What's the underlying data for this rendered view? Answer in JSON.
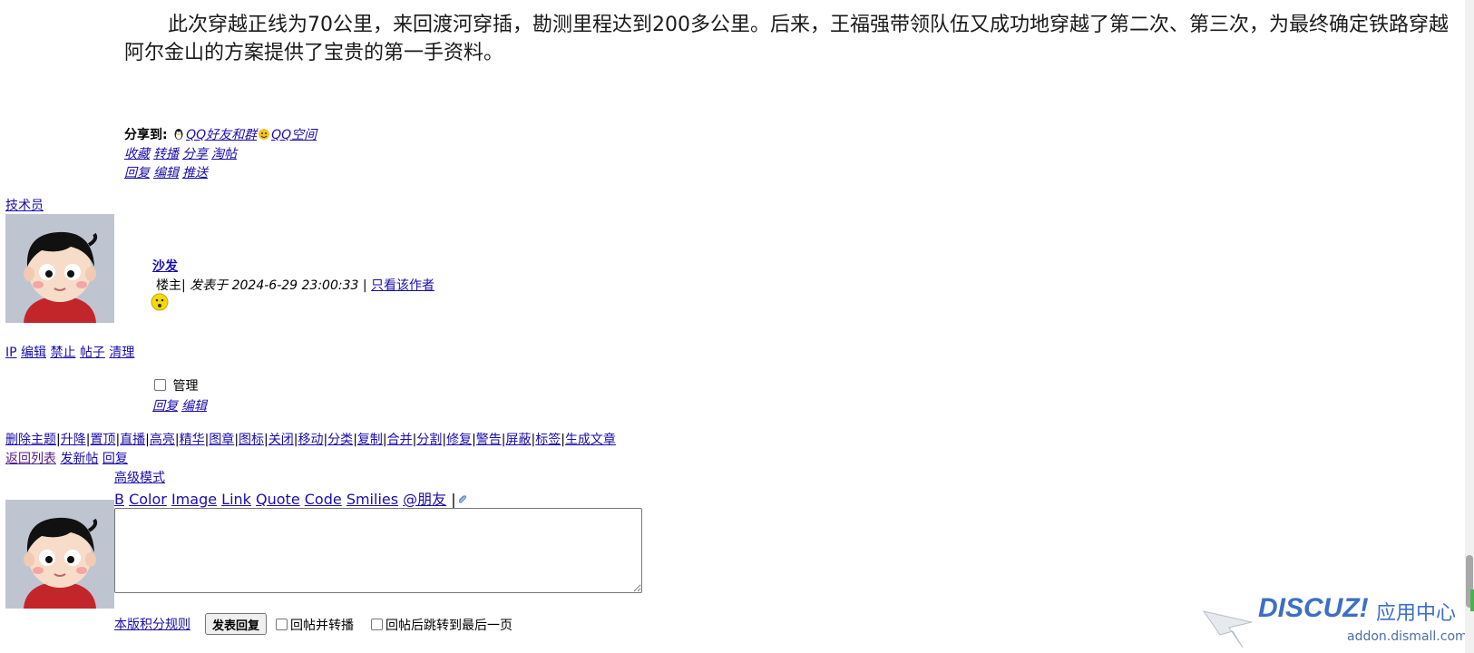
{
  "article": {
    "text": "此次穿越正线为70公里，来回渡河穿插，勘测里程达到200多公里。后来，王福强带领队伍又成功地穿越了第二次、第三次，为最终确定铁路穿越阿尔金山的方案提供了宝贵的第一手资料。"
  },
  "share": {
    "label": "分享到:",
    "qq_friends": "QQ好友和群",
    "qq_zone": "QQ空间"
  },
  "post_actions": {
    "row1": [
      "收藏",
      "转播",
      "分享",
      "淘帖"
    ],
    "row2": [
      "回复",
      "编辑",
      "推送"
    ]
  },
  "reply_post": {
    "author": "技术员",
    "floor": "沙发",
    "role": "楼主",
    "sep": "|",
    "posted_at": "发表于 2024-6-29 23:00:33",
    "only_author": "只看该作者",
    "admin_links": [
      "IP",
      "编辑",
      "禁止",
      "帖子",
      "清理"
    ],
    "manage_label": "管理",
    "actions": [
      "回复",
      "编辑"
    ]
  },
  "mod_bar": [
    "删除主题",
    "升降",
    "置顶",
    "直播",
    "高亮",
    "精华",
    "图章",
    "图标",
    "关闭",
    "移动",
    "分类",
    "复制",
    "合并",
    "分割",
    "修复",
    "警告",
    "屏蔽",
    "标签",
    "生成文章"
  ],
  "nav_links": {
    "back": "返回列表",
    "new_post": "发新帖",
    "reply": "回复"
  },
  "editor": {
    "advanced": "高级模式",
    "toolbar": [
      "B",
      "Color",
      "Image",
      "Link",
      "Quote",
      "Code",
      "Smilies",
      "@朋友"
    ],
    "toolbar_sep": "|",
    "textarea_value": "",
    "rules_link": "本版积分规则",
    "submit": "发表回复",
    "opt_forward": "回帖并转播",
    "opt_jump": "回帖后跳转到最后一页"
  },
  "watermark": {
    "brand": "DISCUZ!",
    "cn": "应用中心",
    "domain": "addon.dismall.com"
  },
  "colors": {
    "link": "#1a0dab",
    "avatar_bg": "#bfc5d0",
    "watermark": "#3d6fc4"
  }
}
